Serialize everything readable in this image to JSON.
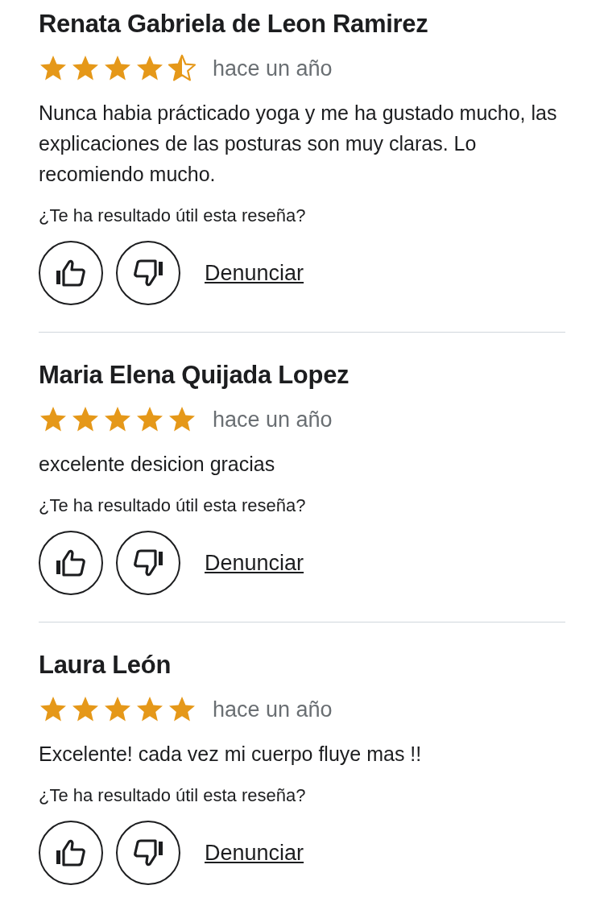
{
  "reviews": [
    {
      "name": "Renata Gabriela de Leon Ramirez",
      "stars": 4.5,
      "date": "hace un año",
      "text": "Nunca habia prácticado yoga y me ha gustado mucho, las explicaciones de las posturas son muy claras. Lo recomiendo mucho.",
      "question": "¿Te ha resultado útil esta reseña?",
      "report": "Denunciar"
    },
    {
      "name": "Maria Elena Quijada Lopez",
      "stars": 5,
      "date": "hace un año",
      "text": "excelente desicion gracias",
      "question": "¿Te ha resultado útil esta reseña?",
      "report": "Denunciar"
    },
    {
      "name": "Laura León",
      "stars": 5,
      "date": "hace un año",
      "text": "Excelente! cada vez mi cuerpo fluye mas !!",
      "question": "¿Te ha resultado útil esta reseña?",
      "report": "Denunciar"
    }
  ]
}
